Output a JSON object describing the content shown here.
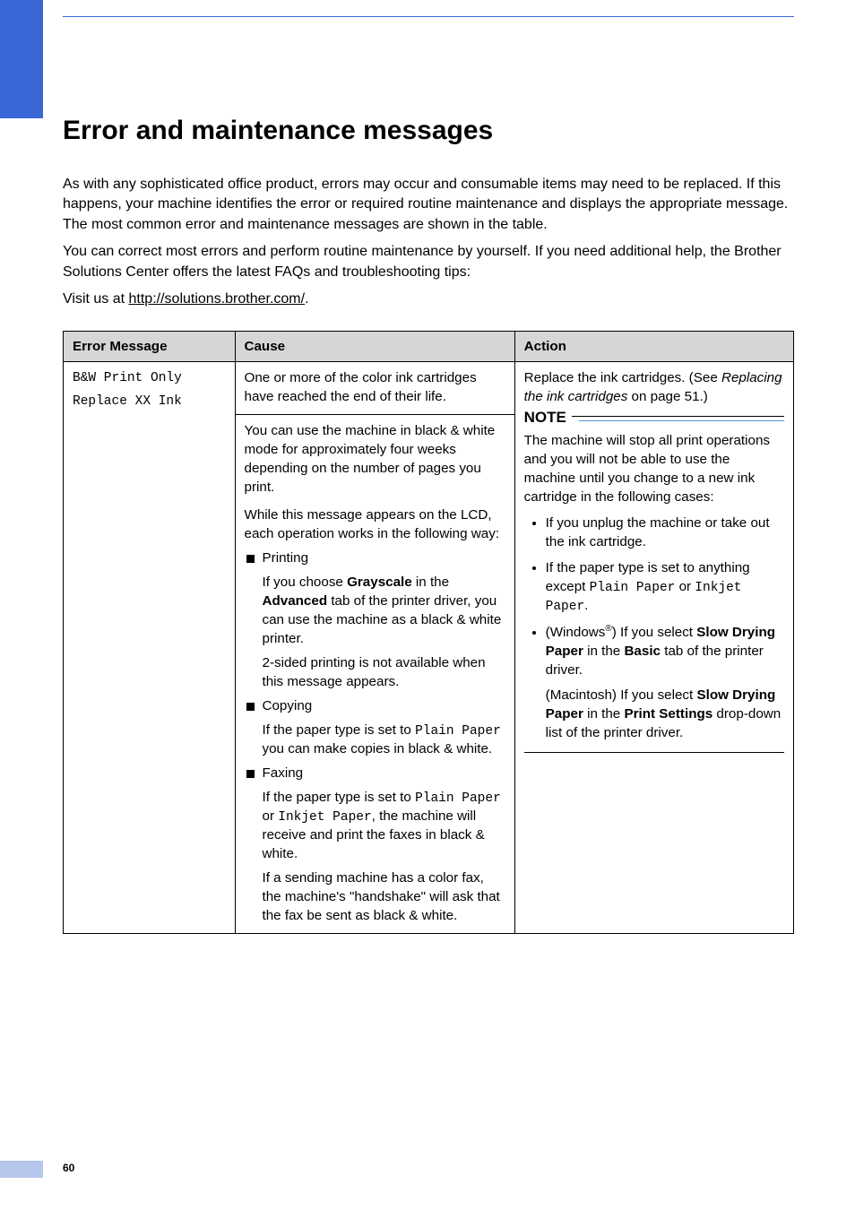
{
  "page_title": "Error and maintenance messages",
  "intro_p1": "As with any sophisticated office product, errors may occur and consumable items may need to be replaced. If this happens, your machine identifies the error or required routine maintenance and displays the appropriate message. The most common error and maintenance messages are shown in the table.",
  "intro_p2": "You can correct most errors and perform routine maintenance by yourself. If you need additional help, the Brother Solutions Center offers the latest FAQs and troubleshooting tips:",
  "intro_p3_pre": "Visit us at ",
  "intro_p3_link": "http://solutions.brother.com/",
  "intro_p3_post": ".",
  "th_msg": "Error Message",
  "th_cause": "Cause",
  "th_action": "Action",
  "row1": {
    "msg1": "B&W Print Only",
    "msg2": "Replace XX Ink",
    "cause_r1": "One or more of the color ink cartridges have reached the end of their life.",
    "cause_r2_p1": "You can use the machine in black & white mode for approximately four weeks depending on the number of pages you print.",
    "cause_r2_p2": "While this message appears on the LCD, each operation works in the following way:",
    "printing_label": "Printing",
    "printing_p1a": "If you choose ",
    "printing_p1_gray": "Grayscale",
    "printing_p1b": " in the ",
    "printing_p1_adv": "Advanced",
    "printing_p1c": " tab of the printer driver, you can use the machine as a black & white printer.",
    "printing_p2": "2-sided printing is not available when this message appears.",
    "copying_label": "Copying",
    "copying_p1a": "If the paper type is set to ",
    "copying_p1_mono": "Plain Paper",
    "copying_p1b": " you can make copies in black & white.",
    "faxing_label": "Faxing",
    "faxing_p1a": "If the paper type is set to ",
    "faxing_p1_m1": "Plain Paper",
    "faxing_p1_or": " or ",
    "faxing_p1_m2": "Inkjet Paper",
    "faxing_p1b": ", the machine will receive and print the faxes in black & white.",
    "faxing_p2": "If a sending machine has a color fax, the machine's \"handshake\" will ask that the fax be sent as black & white.",
    "action_p1a": "Replace the ink cartridges. (See ",
    "action_p1_it": "Replacing the ink cartridges",
    "action_p1b": " on page 51.)",
    "note_title": "NOTE",
    "note_p1": "The machine will stop all print operations and you will not be able to use the machine until you change to a new ink cartridge in the following cases:",
    "note_li1": "If you unplug the machine or take out the ink cartridge.",
    "note_li2a": "If the paper type is set to anything except ",
    "note_li2_m1": "Plain Paper",
    "note_li2_or": " or ",
    "note_li2_m2": "Inkjet Paper",
    "note_li2b": ".",
    "note_li3a": "(Windows",
    "note_li3b": ") If you select ",
    "note_li3_s1": "Slow Drying Paper",
    "note_li3c": " in the ",
    "note_li3_s2": "Basic",
    "note_li3d": " tab of the printer driver.",
    "note_li3_e": "(Macintosh) If you select ",
    "note_li3_s3": "Slow Drying Paper",
    "note_li3_f": " in the ",
    "note_li3_s4": "Print Settings",
    "note_li3_g": " drop-down list of the printer driver."
  },
  "page_number": "60"
}
